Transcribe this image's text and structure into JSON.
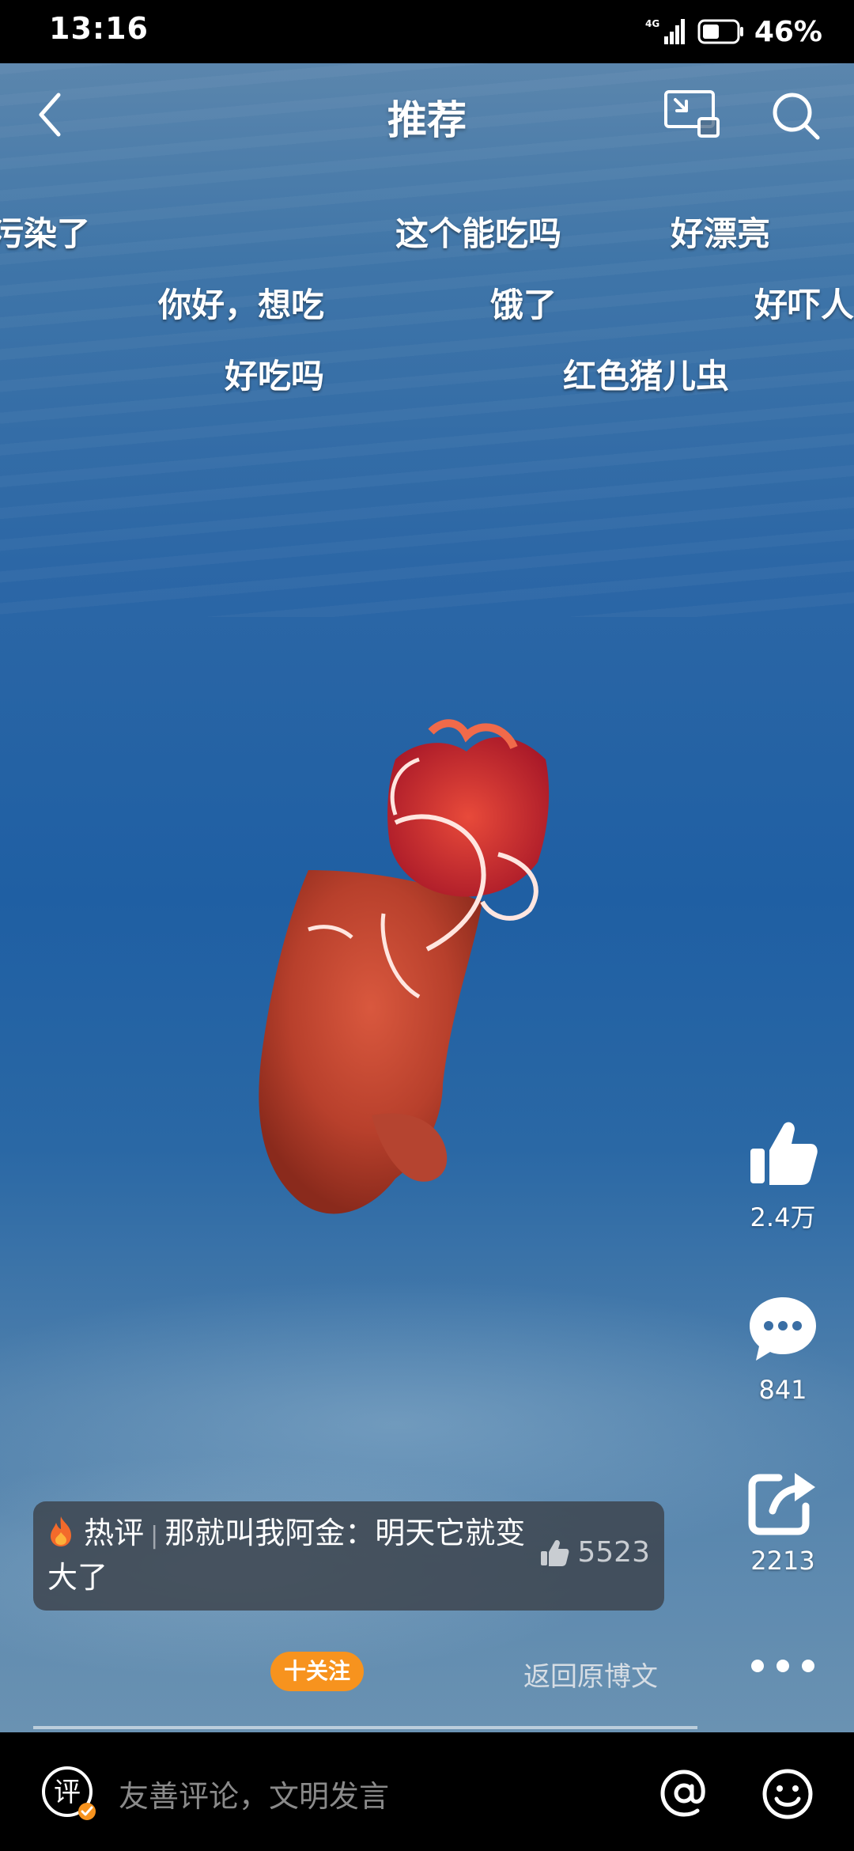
{
  "status_bar": {
    "time": "13:16",
    "network": "4G",
    "battery": "46%"
  },
  "nav": {
    "title": "推荐"
  },
  "danmaku": [
    "污染了",
    "这个能吃吗",
    "好漂亮",
    "你好，想吃",
    "饿了",
    "好吓人",
    "好吃吗",
    "红色猪儿虫"
  ],
  "actions": {
    "likes": "2.4万",
    "comments": "841",
    "shares": "2213"
  },
  "hot_comment": {
    "tag": "热评",
    "user": "那就叫我阿金",
    "separator": "：",
    "text": "明天它就变大了",
    "likes": "5523"
  },
  "follow_label": "十关注",
  "back_to_post": "返回原博文",
  "input_placeholder": "友善评论，文明发言",
  "comment_icon_char": "评",
  "colors": {
    "follow": "#f7931e",
    "video_blue": "#1f5fa3"
  }
}
